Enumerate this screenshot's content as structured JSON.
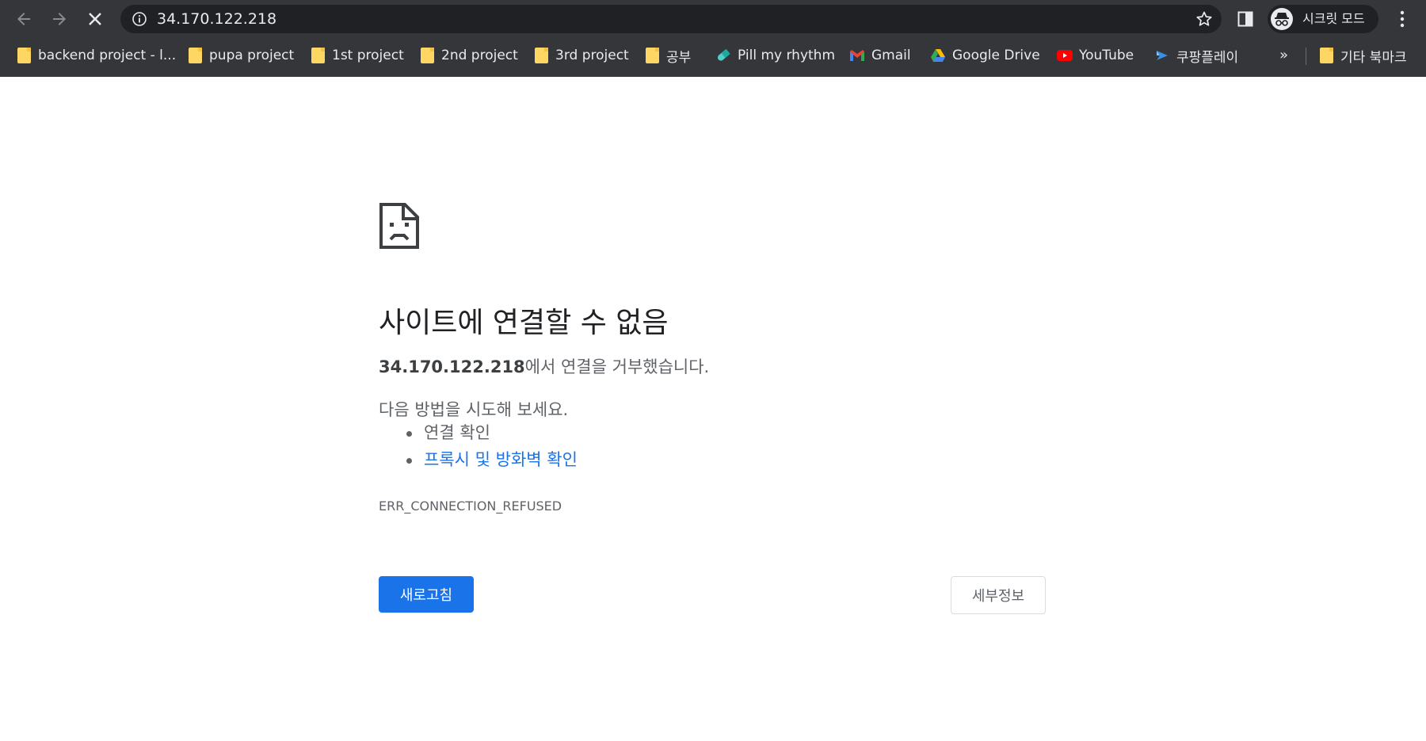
{
  "toolbar": {
    "url": "34.170.122.218",
    "profile_label": "시크릿 모드"
  },
  "bookmarks": {
    "items": [
      {
        "label": "backend project - l...",
        "icon": "folder-icon"
      },
      {
        "label": "pupa project",
        "icon": "folder-icon"
      },
      {
        "label": "1st project",
        "icon": "folder-icon"
      },
      {
        "label": "2nd project",
        "icon": "folder-icon"
      },
      {
        "label": "3rd project",
        "icon": "folder-icon"
      },
      {
        "label": "공부",
        "icon": "folder-icon"
      },
      {
        "label": "Pill my rhythm",
        "icon": "pill-icon"
      },
      {
        "label": "Gmail",
        "icon": "gmail-icon"
      },
      {
        "label": "Google Drive",
        "icon": "drive-icon"
      },
      {
        "label": "YouTube",
        "icon": "youtube-icon"
      },
      {
        "label": "쿠팡플레이",
        "icon": "coupang-play-icon"
      }
    ],
    "overflow_label": "»",
    "other_bookmarks_label": "기타 북마크"
  },
  "error": {
    "title": "사이트에 연결할 수 없음",
    "host": "34.170.122.218",
    "description_suffix": "에서 연결을 거부했습니다.",
    "try_text": "다음 방법을 시도해 보세요.",
    "suggestions": [
      "연결 확인",
      "프록시 및 방화벽 확인"
    ],
    "code": "ERR_CONNECTION_REFUSED",
    "reload_label": "새로고침",
    "details_label": "세부정보"
  },
  "colors": {
    "chrome_dark": "#35363a",
    "omnibox": "#202124",
    "accent": "#1a73e8",
    "text_secondary": "#5f6368"
  }
}
